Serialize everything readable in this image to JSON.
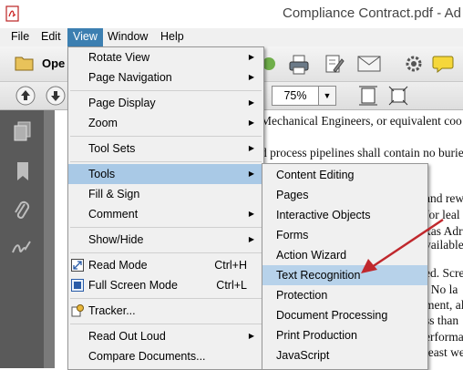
{
  "window": {
    "title": "Compliance Contract.pdf - Ad"
  },
  "menubar": {
    "items": [
      "File",
      "Edit",
      "View",
      "Window",
      "Help"
    ],
    "active": "View"
  },
  "toolbar": {
    "open_label": "Ope",
    "zoom_value": "75%"
  },
  "document": {
    "lines": [
      "Mechanical Engineers, or equivalent coo",
      "d process pipelines shall contain no burie",
      "and rew",
      "for leal",
      "xas Adr",
      "vailable",
      "ed. Scre",
      ". No la",
      "ment, al",
      "ss than",
      "erforma",
      "least we"
    ]
  },
  "view_menu": {
    "items": [
      {
        "label": "Rotate View",
        "submenu": true
      },
      {
        "label": "Page Navigation",
        "submenu": true
      },
      {
        "label": "Page Display",
        "submenu": true
      },
      {
        "label": "Zoom",
        "submenu": true
      },
      {
        "label": "Tool Sets",
        "submenu": true
      },
      {
        "label": "Tools",
        "submenu": true
      },
      {
        "label": "Fill & Sign"
      },
      {
        "label": "Comment",
        "submenu": true
      },
      {
        "label": "Show/Hide",
        "submenu": true
      },
      {
        "label": "Read Mode",
        "shortcut": "Ctrl+H"
      },
      {
        "label": "Full Screen Mode",
        "shortcut": "Ctrl+L"
      },
      {
        "label": "Tracker..."
      },
      {
        "label": "Read Out Loud",
        "submenu": true
      },
      {
        "label": "Compare Documents..."
      }
    ]
  },
  "tools_submenu": {
    "items": [
      "Content Editing",
      "Pages",
      "Interactive Objects",
      "Forms",
      "Action Wizard",
      "Text Recognition",
      "Protection",
      "Document Processing",
      "Print Production",
      "JavaScript"
    ],
    "highlighted": "Text Recognition"
  },
  "colors": {
    "menu_active": "#3c7fb1",
    "item_highlight": "#b7d2ea",
    "annotation_arrow": "#c0282d"
  }
}
